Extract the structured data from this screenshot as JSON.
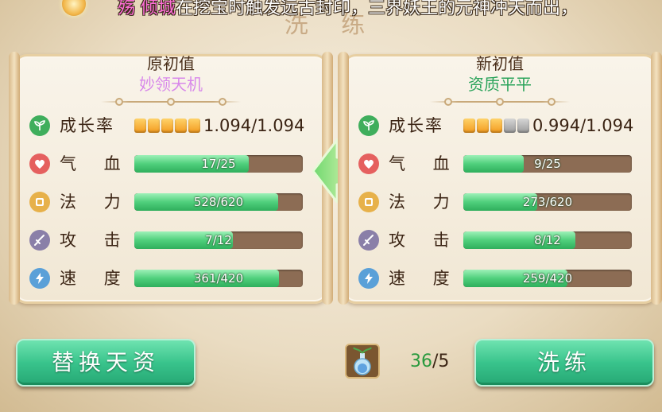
{
  "title": "洗 练",
  "marquee": {
    "name": "殇 倾城",
    "text": "在挖宝时触发远古封印，三界妖王的元神冲天而出，"
  },
  "original": {
    "header": "原初值",
    "quality": "妙领天机",
    "growth": {
      "label": "成长率",
      "pips_filled": 5,
      "pips_total": 5,
      "value": "1.094/1.094"
    },
    "stats": [
      {
        "label": "气 血",
        "text": "17/25",
        "fraction": 0.68,
        "icon": "heart-icon",
        "icon_color": "#e5605f"
      },
      {
        "label": "法 力",
        "text": "528/620",
        "fraction": 0.852,
        "icon": "mana-icon",
        "icon_color": "#e7b14a"
      },
      {
        "label": "攻 击",
        "text": "7/12",
        "fraction": 0.583,
        "icon": "sword-icon",
        "icon_color": "#8a7fa8"
      },
      {
        "label": "速 度",
        "text": "361/420",
        "fraction": 0.86,
        "icon": "lightning-icon",
        "icon_color": "#5aa0d8"
      }
    ]
  },
  "new": {
    "header": "新初值",
    "quality": "资质平平",
    "growth": {
      "label": "成长率",
      "pips_filled": 3,
      "pips_total": 5,
      "value": "0.994/1.094"
    },
    "stats": [
      {
        "label": "气 血",
        "text": "9/25",
        "fraction": 0.36,
        "icon": "heart-icon",
        "icon_color": "#e5605f"
      },
      {
        "label": "法 力",
        "text": "273/620",
        "fraction": 0.44,
        "icon": "mana-icon",
        "icon_color": "#e7b14a"
      },
      {
        "label": "攻 击",
        "text": "8/12",
        "fraction": 0.667,
        "icon": "sword-icon",
        "icon_color": "#8a7fa8"
      },
      {
        "label": "速 度",
        "text": "259/420",
        "fraction": 0.617,
        "icon": "lightning-icon",
        "icon_color": "#5aa0d8"
      }
    ]
  },
  "growth_icon_color": "#3fae5c",
  "pip_filled_color": "#f39a1e",
  "pip_empty_color": "#9b9b9b",
  "buttons": {
    "replace": "替换天资",
    "refine": "洗练"
  },
  "item": {
    "icon": "potion-icon"
  },
  "count": {
    "have": "36",
    "sep": "/",
    "need": "5"
  }
}
